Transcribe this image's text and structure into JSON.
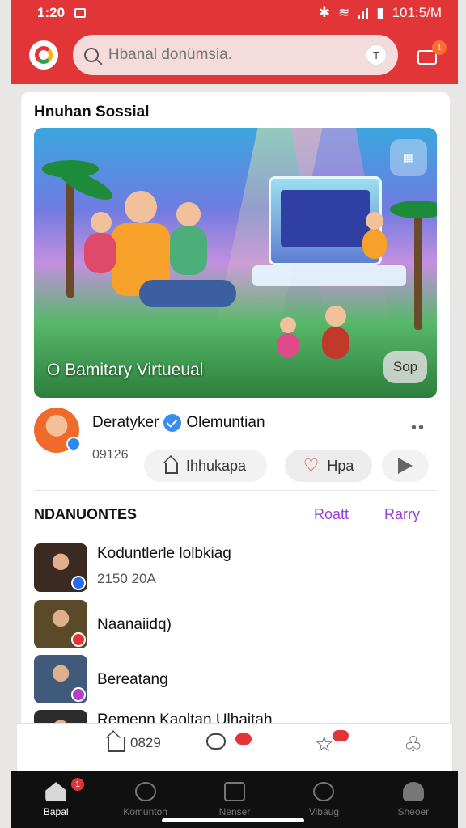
{
  "status": {
    "time": "1:20",
    "right_text": "101:5/M"
  },
  "search": {
    "placeholder": "Hbanal donümsia.",
    "lens_label": "T"
  },
  "inbox": {
    "badge": "1"
  },
  "section": {
    "title": "Hnuhan Sossial"
  },
  "hero": {
    "caption": "O Bamitary Virtueual",
    "tag": "Sop"
  },
  "post": {
    "author": "Deratyker",
    "community": "Olemuntian",
    "meta": "09126",
    "home_button": "Ihhukapa",
    "like_button": "Hpa"
  },
  "list": {
    "header": "NDANUONTES",
    "link_a": "Roatt",
    "link_b": "Rarry",
    "items": [
      {
        "title": "Koduntlerle lolbkiag",
        "sub": "2150 20A",
        "thumb_color": "#3a2a22",
        "mini_color": "#2a6cf0"
      },
      {
        "title": "Naanaiidq)",
        "sub": "",
        "thumb_color": "#5a4a2a",
        "mini_color": "#e23538"
      },
      {
        "title": "Bereatang",
        "sub": "",
        "thumb_color": "#3f5a7a",
        "mini_color": "#b53fc8"
      },
      {
        "title": "Remenn Kaoltan Ulhaitah",
        "sub": "",
        "thumb_color": "#2c2c2c",
        "mini_color": "#e23538"
      }
    ]
  },
  "quickbar": {
    "count_label": "0829"
  },
  "nav": {
    "items": [
      {
        "label": "Bapal"
      },
      {
        "label": "Komunton"
      },
      {
        "label": "Nenser"
      },
      {
        "label": "Vibaug"
      },
      {
        "label": "Sheoer"
      }
    ],
    "badge": "1"
  },
  "colors": {
    "brand_red": "#e23538",
    "link_purple": "#9b3fd8",
    "nav_bg": "#101010"
  }
}
